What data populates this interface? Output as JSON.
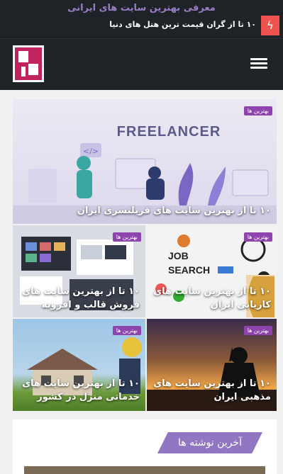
{
  "header": {
    "tagline": "معرفی بهترین سایت های ایرانی",
    "ticker_icon": "lightning-icon",
    "ticker_text": "۱۰ تا از گران قیمت ترین هتل های دنیا",
    "logo": "site-logo",
    "menu_icon": "hamburger-icon"
  },
  "featured": [
    {
      "badge": "بهترین ها",
      "title": "۱۰ تا از بهترین سایت های فریلنسری ایران",
      "image_text": "FREELANCER"
    },
    {
      "badge": "بهترین ها",
      "title": "۱۰ تا از بهترین سایت های فروش قالب و افزونه"
    },
    {
      "badge": "بهترین ها",
      "title": "۱۰ تا از بهترین سایت های کاریابی ایران",
      "image_text_1": "JOB",
      "image_text_2": "SEARCH"
    },
    {
      "badge": "بهترین ها",
      "title": "۱۰ تا از بهترین سایت های خدماتی منزل در کشور"
    },
    {
      "badge": "بهترین ها",
      "title": "۱۰ تا از بهترین سایت های مذهبی ایران"
    }
  ],
  "latest": {
    "title": "آخرین نوشته ها"
  },
  "colors": {
    "header_bg": "#1e2328",
    "accent_purple": "#8e44ad",
    "ticker_red": "#ef5350",
    "logo_magenta": "#c0235e"
  }
}
